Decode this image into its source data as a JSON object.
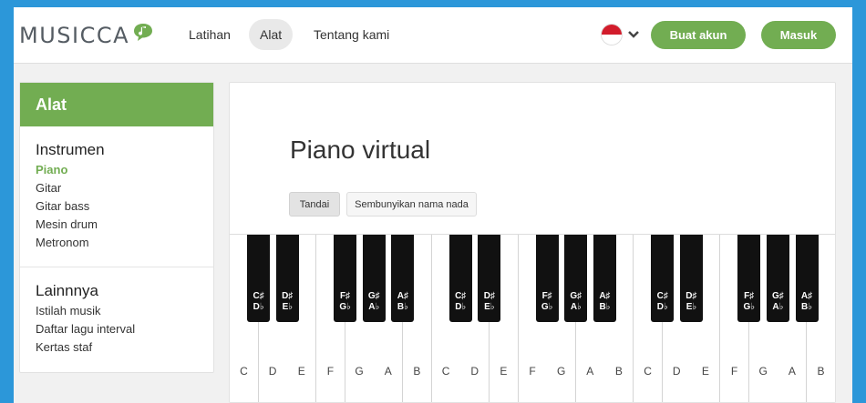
{
  "header": {
    "logo_text": "MUSICCA",
    "nav": [
      "Latihan",
      "Alat",
      "Tentang kami"
    ],
    "active_nav": "Alat",
    "create_account": "Buat akun",
    "login": "Masuk",
    "colors": {
      "accent": "#72ad52",
      "background": "#2c97d9"
    }
  },
  "sidebar": {
    "title": "Alat",
    "sections": [
      {
        "heading": "Instrumen",
        "links": [
          "Piano",
          "Gitar",
          "Gitar bass",
          "Mesin drum",
          "Metronom"
        ]
      },
      {
        "heading": "Lainnnya",
        "links": [
          "Istilah musik",
          "Daftar lagu interval",
          "Kertas staf"
        ]
      }
    ],
    "active_link": "Piano"
  },
  "main": {
    "title": "Piano virtual",
    "buttons": {
      "mark": "Tandai",
      "hide_names": "Sembunyikan nama nada"
    }
  },
  "piano": {
    "white_keys": [
      "C",
      "D",
      "E",
      "F",
      "G",
      "A",
      "B",
      "C",
      "D",
      "E",
      "F",
      "G",
      "A",
      "B",
      "C",
      "D",
      "E",
      "F",
      "G",
      "A",
      "B"
    ],
    "black_keys": [
      [
        "C♯",
        "D♭"
      ],
      [
        "D♯",
        "E♭"
      ],
      [
        "F♯",
        "G♭"
      ],
      [
        "G♯",
        "A♭"
      ],
      [
        "A♯",
        "B♭"
      ],
      [
        "C♯",
        "D♭"
      ],
      [
        "D♯",
        "E♭"
      ],
      [
        "F♯",
        "G♭"
      ],
      [
        "G♯",
        "A♭"
      ],
      [
        "A♯",
        "B♭"
      ],
      [
        "C♯",
        "D♭"
      ],
      [
        "D♯",
        "E♭"
      ],
      [
        "F♯",
        "G♭"
      ],
      [
        "G♯",
        "A♭"
      ],
      [
        "A♯",
        "B♭"
      ]
    ]
  }
}
